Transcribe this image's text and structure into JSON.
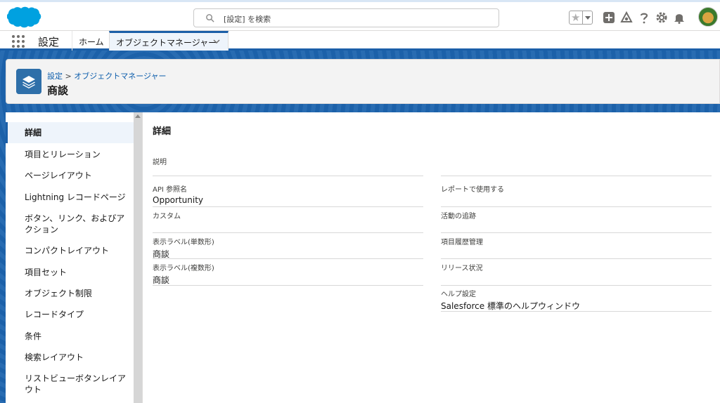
{
  "colors": {
    "brand_blue": "#1b5fa8",
    "link": "#0b5cab",
    "icon_tile": "#2e6fa9"
  },
  "header": {
    "search_placeholder": "[設定] を検索",
    "icons": [
      "salesforce-logo",
      "favorites-star-icon",
      "add-icon",
      "trailhead-icon",
      "help-icon",
      "setup-gear-icon",
      "notifications-bell-icon",
      "user-avatar"
    ]
  },
  "nav": {
    "app_name": "設定",
    "home_tab": "ホーム",
    "active_tab": "オブジェクトマネージャー"
  },
  "page_header": {
    "breadcrumb_setup": "設定",
    "breadcrumb_sep": ">",
    "breadcrumb_object_manager": "オブジェクトマネージャー",
    "title": "商談"
  },
  "sidebar": {
    "items": [
      {
        "label": "詳細"
      },
      {
        "label": "項目とリレーション"
      },
      {
        "label": "ページレイアウト"
      },
      {
        "label": "Lightning レコードページ"
      },
      {
        "label": "ボタン、リンク、およびアクション"
      },
      {
        "label": "コンパクトレイアウト"
      },
      {
        "label": "項目セット"
      },
      {
        "label": "オブジェクト制限"
      },
      {
        "label": "レコードタイプ"
      },
      {
        "label": "条件"
      },
      {
        "label": "検索レイアウト"
      },
      {
        "label": "リストビューボタンレイアウト"
      }
    ]
  },
  "details": {
    "section_title": "詳細",
    "left": [
      {
        "label": "説明",
        "value": ""
      },
      {
        "label": "API 参照名",
        "value": "Opportunity"
      },
      {
        "label": "カスタム",
        "value": ""
      },
      {
        "label": "表示ラベル(単数形)",
        "value": "商談"
      },
      {
        "label": "表示ラベル(複数形)",
        "value": "商談"
      }
    ],
    "right": [
      {
        "label": "",
        "value": ""
      },
      {
        "label": "レポートで使用する",
        "value": ""
      },
      {
        "label": "活動の追跡",
        "value": ""
      },
      {
        "label": "項目履歴管理",
        "value": ""
      },
      {
        "label": "リリース状況",
        "value": ""
      },
      {
        "label": "ヘルプ設定",
        "value": "Salesforce 標準のヘルプウィンドウ"
      }
    ]
  }
}
